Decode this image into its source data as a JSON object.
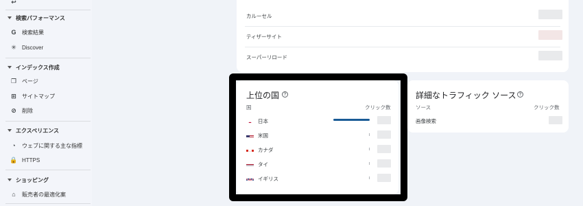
{
  "sidebar": {
    "sections": [
      {
        "label": "検索パフォーマンス",
        "items": [
          {
            "label": "検索結果",
            "icon": "google-g-icon"
          },
          {
            "label": "Discover",
            "icon": "asterisk-icon"
          }
        ]
      },
      {
        "label": "インデックス作成",
        "items": [
          {
            "label": "ページ",
            "icon": "pages-icon"
          },
          {
            "label": "サイトマップ",
            "icon": "sitemap-icon"
          },
          {
            "label": "削除",
            "icon": "removals-icon"
          }
        ]
      },
      {
        "label": "エクスペリエンス",
        "items": [
          {
            "label": "ウェブに関する主な指標",
            "icon": "gauge-icon"
          },
          {
            "label": "HTTPS",
            "icon": "lock-icon"
          }
        ]
      },
      {
        "label": "ショッピング",
        "items": [
          {
            "label": "販売者の最適化案",
            "icon": "tag-icon"
          }
        ]
      }
    ]
  },
  "top_card": {
    "rows": [
      "カルーセル",
      "ティザーサイト",
      "スーパーリロード"
    ]
  },
  "countries_card": {
    "title": "上位の国",
    "col_country": "国",
    "col_clicks": "クリック数",
    "rows": [
      {
        "name": "日本",
        "flag": "jp-flag-icon",
        "share": 1.0
      },
      {
        "name": "米国",
        "flag": "us-flag-icon",
        "share": 0.0
      },
      {
        "name": "カナダ",
        "flag": "ca-flag-icon",
        "share": 0.0
      },
      {
        "name": "タイ",
        "flag": "th-flag-icon",
        "share": 0.0
      },
      {
        "name": "イギリス",
        "flag": "gb-flag-icon",
        "share": 0.0
      }
    ]
  },
  "traffic_card": {
    "title": "詳細なトラフィック ソース",
    "col_source": "ソース",
    "col_clicks": "クリック数",
    "rows": [
      {
        "name": "画像検索"
      }
    ]
  },
  "colors": {
    "accent_bar": "#1a5b96",
    "highlight_border": "#000000"
  }
}
